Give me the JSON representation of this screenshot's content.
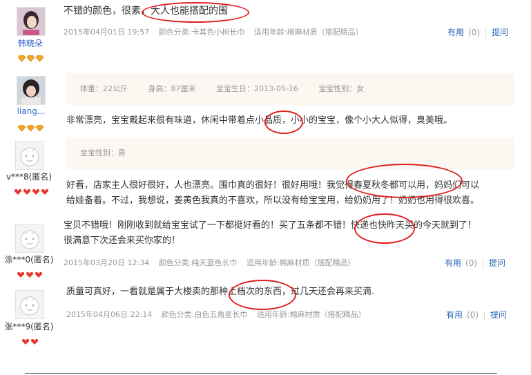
{
  "colors": {
    "accent_red": "#e0201e",
    "link_blue": "#2b65b7",
    "meta_gray": "#999999",
    "info_bg": "#fbf7f1"
  },
  "reviews": [
    {
      "user": "韩晓朵",
      "avatar": "user-photo-avatar",
      "text": "不错的颜色，很素，大人也能搭配的围",
      "date": "2015年04月01日 19:57",
      "color_cat": "颜色分类:卡其色小树长巾",
      "age": "适用年龄:棉麻材质（搭配精品）",
      "useful": "有用",
      "count": "(0)",
      "ask": "提问"
    },
    {
      "user": "liang...",
      "avatar": "user-photo-avatar",
      "info": [
        "体重：22公斤",
        "身高：87厘米",
        "宝宝生日：2013-05-16",
        "宝宝性别：女"
      ],
      "text": "非常漂亮，宝宝戴起来很有味道，休闲中带着点小品质，小小的宝宝，像个小大人似得，臭美哦。"
    },
    {
      "user": "v***8(匿名)",
      "avatar": "default-face-avatar",
      "info": [
        "宝宝性别：男"
      ],
      "text_line1": "好看，店家主人很好很好，人也漂亮。围巾真的很好！很好用哦！我觉得春夏秋冬都可以用，妈妈们可以",
      "text_line2": "给娃备着。不过，我想说，姜黄色我真的不喜欢，所以没有给宝宝用，给奶奶用了！奶奶也用得很欢喜。"
    },
    {
      "user": "涂***0(匿名)",
      "avatar": "default-face-avatar",
      "text_line1": "宝贝不错哦！刚刚收到就给宝宝试了一下都挺好看的！买了五条都不错！快递也快昨天买的今天就到了！",
      "text_line2": "很满意下次还会来买你家的！",
      "date": "2015年03月20日 12:34",
      "color_cat": "颜色分类:纯天蓝色长巾",
      "age": "适用年龄:棉麻材质（搭配精品）",
      "useful": "有用",
      "count": "(0)",
      "ask": "提问"
    },
    {
      "user": "张***9(匿名)",
      "avatar": "default-face-avatar",
      "text": "质量可真好，一看就是属于大楼卖的那种上档次的东西，过几天还会再来买滴.",
      "date": "2015年04月06日 22:14",
      "color_cat": "颜色分类:白色五角星长巾",
      "age": "适用年龄:棉麻材质（搭配精品）",
      "useful": "有用",
      "count": "(0)",
      "ask": "提问"
    }
  ]
}
